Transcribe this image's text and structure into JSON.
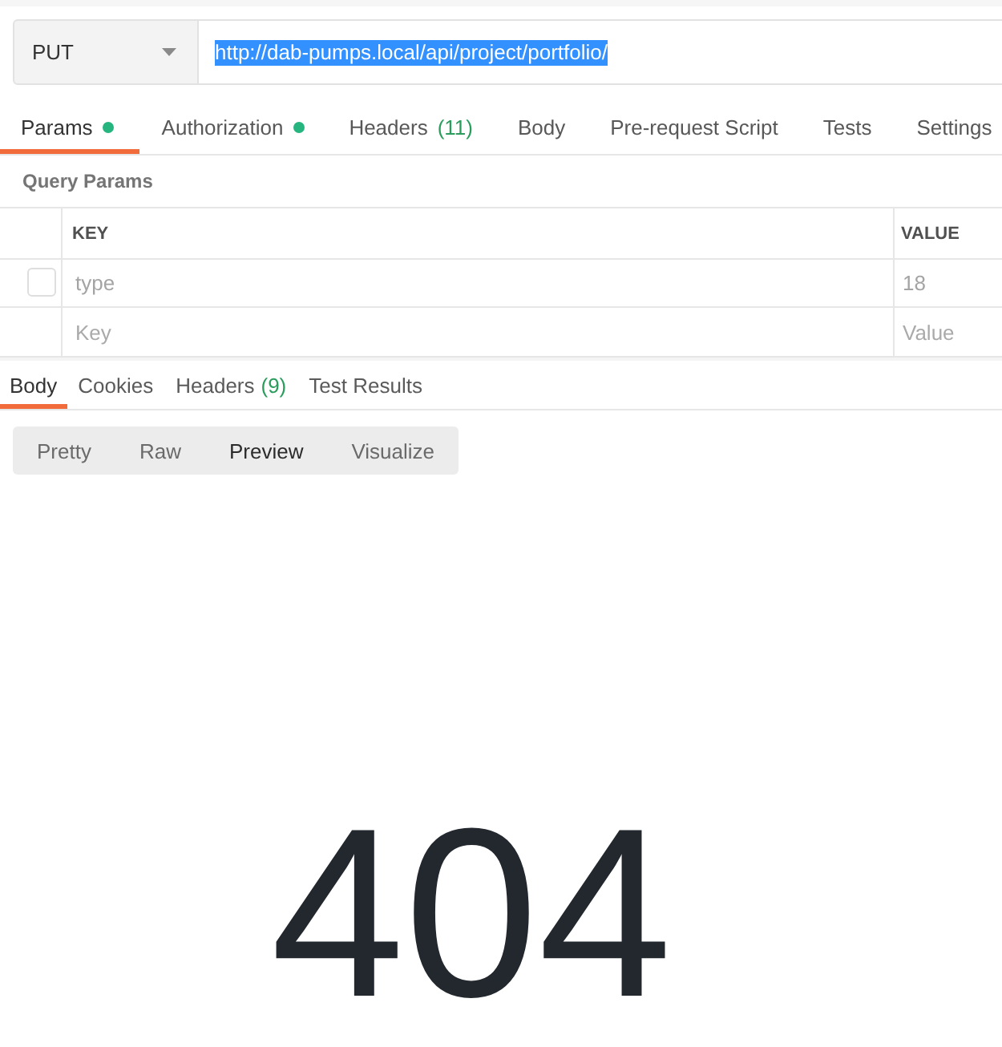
{
  "request": {
    "method": "PUT",
    "url": {
      "value": "http://dab-pumps.local/api/project/portfolio/",
      "highlighted": true
    }
  },
  "request_tabs": [
    {
      "label": "Params",
      "selected": true,
      "indicator": true
    },
    {
      "label": "Authorization",
      "selected": false,
      "indicator": true
    },
    {
      "label": "Headers",
      "count": "(11)",
      "selected": false,
      "indicator": false
    },
    {
      "label": "Body",
      "selected": false,
      "indicator": false
    },
    {
      "label": "Pre-request Script",
      "selected": false,
      "indicator": false
    },
    {
      "label": "Tests",
      "selected": false,
      "indicator": false
    },
    {
      "label": "Settings",
      "selected": false,
      "indicator": false
    }
  ],
  "query_params": {
    "title": "Query Params",
    "columns": [
      "KEY",
      "VALUE"
    ],
    "rows": [
      {
        "checked": false,
        "key": "type",
        "value": "18"
      }
    ],
    "new_row": {
      "key_placeholder": "Key",
      "value_placeholder": "Value"
    }
  },
  "response_tabs": [
    {
      "label": "Body",
      "selected": true
    },
    {
      "label": "Cookies",
      "selected": false
    },
    {
      "label": "Headers",
      "count": "(9)",
      "selected": false
    },
    {
      "label": "Test Results",
      "selected": false
    }
  ],
  "body_view_modes": [
    {
      "label": "Pretty",
      "selected": false
    },
    {
      "label": "Raw",
      "selected": false
    },
    {
      "label": "Preview",
      "selected": true
    },
    {
      "label": "Visualize",
      "selected": false
    }
  ],
  "response_preview": {
    "text": "404"
  }
}
